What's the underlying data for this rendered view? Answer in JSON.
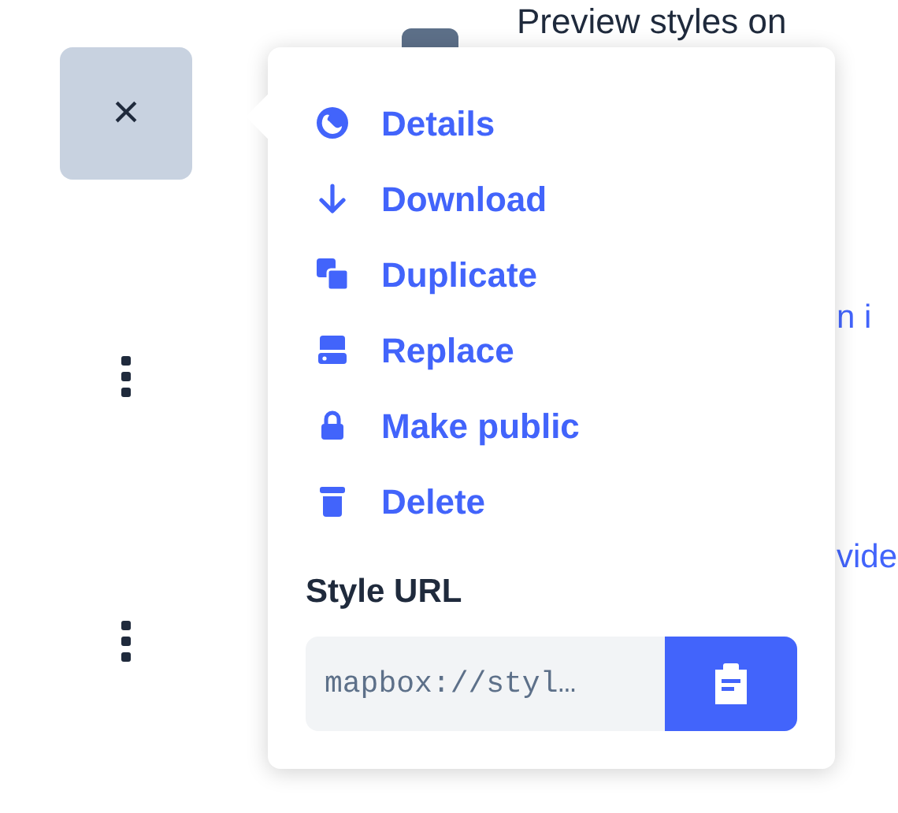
{
  "background": {
    "heading": "Preview styles on",
    "link_1": "n i",
    "link_2": "vide"
  },
  "close_button": {
    "label": "×"
  },
  "menu": {
    "items": [
      {
        "label": "Details"
      },
      {
        "label": "Download"
      },
      {
        "label": "Duplicate"
      },
      {
        "label": "Replace"
      },
      {
        "label": "Make public"
      },
      {
        "label": "Delete"
      }
    ],
    "style_url": {
      "label": "Style URL",
      "value": "mapbox://styl…"
    }
  }
}
